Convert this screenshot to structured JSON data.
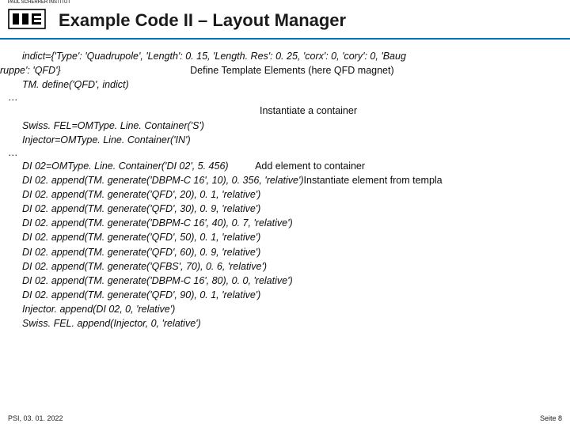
{
  "header": {
    "logo_text": "PAUL SCHERRER INSTITUT",
    "title": "Example Code II – Layout Manager"
  },
  "body": {
    "line1": "indict={'Type': 'Quadrupole', 'Length': 0. 15, 'Length. Res': 0. 25, 'corx': 0, 'cory': 0, 'Baug",
    "line2a": "ruppe': 'QFD'}",
    "line2b": "Define Template Elements (here QFD magnet)",
    "line3": "TM. define('QFD', indict)",
    "ell": "…",
    "line4b": "Instantiate a container",
    "line5": "Swiss. FEL=OMType. Line. Container('S')",
    "line6": "Injector=OMType. Line. Container('IN')",
    "line7a": "DI 02=OMType. Line. Container('DI 02', 5. 456)",
    "line7b": "Add element to container",
    "line8a": "DI 02. append(TM. generate('DBPM-C 16', 10), 0. 356, 'relative')",
    "line8b": "Instantiate element from templa",
    "line9": "DI 02. append(TM. generate('QFD', 20), 0. 1, 'relative')",
    "line10": "DI 02. append(TM. generate('QFD', 30), 0. 9, 'relative')",
    "line11": "DI 02. append(TM. generate('DBPM-C 16', 40), 0. 7, 'relative')",
    "line12": "DI 02. append(TM. generate('QFD', 50), 0. 1, 'relative')",
    "line13": "DI 02. append(TM. generate('QFD', 60), 0. 9, 'relative')",
    "line14": "DI 02. append(TM. generate('QFBS', 70), 0. 6, 'relative')",
    "line15": "DI 02. append(TM. generate('DBPM-C 16', 80), 0. 0, 'relative')",
    "line16": "DI 02. append(TM. generate('QFD', 90), 0. 1, 'relative')",
    "line17": "Injector. append(DI 02, 0, 'relative')",
    "line18": "Swiss. FEL. append(Injector, 0, 'relative')"
  },
  "footer": {
    "left": "PSI, 03. 01. 2022",
    "right": "Seite 8"
  }
}
